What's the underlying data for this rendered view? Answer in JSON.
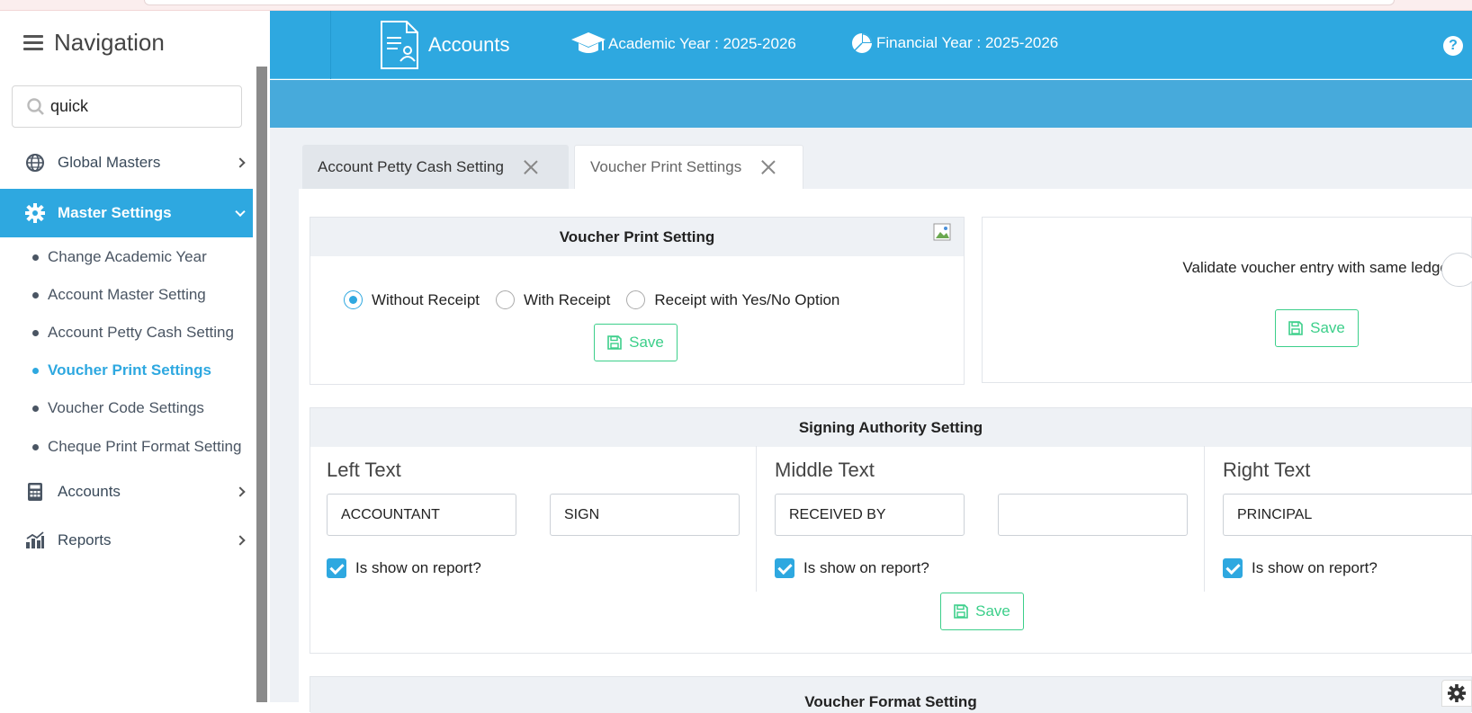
{
  "sidebar": {
    "title": "Navigation",
    "search_value": "quick",
    "menu": [
      {
        "label": "Global Masters",
        "icon": "globe-icon"
      },
      {
        "label": "Master Settings",
        "icon": "gear-icon"
      },
      {
        "label": "Accounts",
        "icon": "calculator-icon"
      },
      {
        "label": "Reports",
        "icon": "bar-chart-icon"
      }
    ],
    "submenu": [
      {
        "label": "Change Academic Year"
      },
      {
        "label": "Account Master Setting"
      },
      {
        "label": "Account Petty Cash Setting"
      },
      {
        "label": "Voucher Print Settings"
      },
      {
        "label": "Voucher Code Settings"
      },
      {
        "label": "Cheque Print Format Setting"
      }
    ]
  },
  "header": {
    "module": "Accounts",
    "academic_year": "Academic Year : 2025-2026",
    "financial_year": "Financial Year : 2025-2026",
    "help": "?"
  },
  "tabs": [
    {
      "label": "Account Petty Cash Setting"
    },
    {
      "label": "Voucher Print Settings"
    }
  ],
  "voucher_print": {
    "title": "Voucher Print Setting",
    "options": [
      "Without Receipt",
      "With Receipt",
      "Receipt with Yes/No Option"
    ],
    "selected": "Without Receipt",
    "save": "Save"
  },
  "validate": {
    "question": "Validate voucher entry with same ledger?",
    "save": "Save"
  },
  "signing": {
    "title": "Signing Authority Setting",
    "left": {
      "title": "Left Text",
      "value1": "ACCOUNTANT",
      "value2": "SIGN",
      "show": "Is show on report?"
    },
    "middle": {
      "title": "Middle Text",
      "value1": "RECEIVED BY",
      "value2": "",
      "show": "Is show on report?"
    },
    "right": {
      "title": "Right Text",
      "value1": "PRINCIPAL",
      "show": "Is show on report?"
    },
    "save": "Save"
  },
  "voucher_format": {
    "title": "Voucher Format Setting"
  },
  "colors": {
    "primary": "#2ea8e0",
    "success": "#3ccf8a"
  }
}
